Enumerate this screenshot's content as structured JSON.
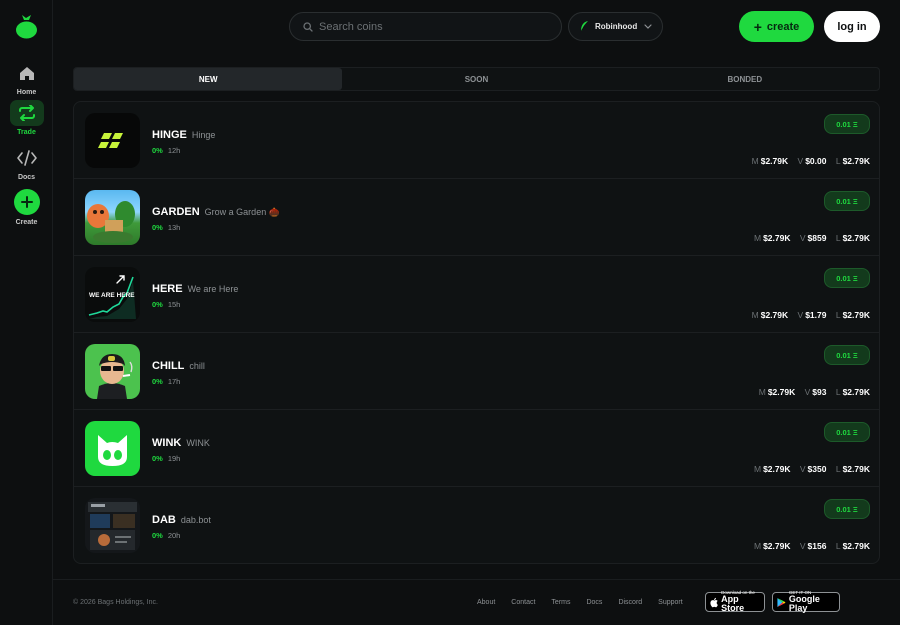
{
  "sidebar": {
    "items": [
      {
        "label": "Home",
        "icon": "home-icon"
      },
      {
        "label": "Trade",
        "icon": "swap-icon"
      },
      {
        "label": "Docs",
        "icon": "code-icon"
      },
      {
        "label": "Create",
        "icon": "plus-icon"
      }
    ]
  },
  "topbar": {
    "search_placeholder": "Search coins",
    "chain_label": "Robinhood",
    "create_label": "create",
    "login_label": "log in"
  },
  "tabs": [
    "NEW",
    "SOON",
    "BONDED"
  ],
  "coins": [
    {
      "ticker": "HINGE",
      "name": "Hinge",
      "change": "0%",
      "age": "12h",
      "buy": "0.01 Ξ",
      "m": "$2.79K",
      "v": "$0.00",
      "l": "$2.79K"
    },
    {
      "ticker": "GARDEN",
      "name": "Grow a Garden 🌰",
      "change": "0%",
      "age": "13h",
      "buy": "0.01 Ξ",
      "m": "$2.79K",
      "v": "$859",
      "l": "$2.79K"
    },
    {
      "ticker": "HERE",
      "name": "We are Here",
      "change": "0%",
      "age": "15h",
      "buy": "0.01 Ξ",
      "m": "$2.79K",
      "v": "$1.79",
      "l": "$2.79K"
    },
    {
      "ticker": "CHILL",
      "name": "chill",
      "change": "0%",
      "age": "17h",
      "buy": "0.01 Ξ",
      "m": "$2.79K",
      "v": "$93",
      "l": "$2.79K"
    },
    {
      "ticker": "WINK",
      "name": "WINK",
      "change": "0%",
      "age": "19h",
      "buy": "0.01 Ξ",
      "m": "$2.79K",
      "v": "$350",
      "l": "$2.79K"
    },
    {
      "ticker": "DAB",
      "name": "dab.bot",
      "change": "0%",
      "age": "20h",
      "buy": "0.01 Ξ",
      "m": "$2.79K",
      "v": "$156",
      "l": "$2.79K"
    }
  ],
  "stat_keys": {
    "m": "M",
    "v": "V",
    "l": "L"
  },
  "thumb_texts": {
    "here": "WE ARE HERE"
  },
  "footer": {
    "copyright": "© 2026 Bags Holdings, Inc.",
    "links": [
      "About",
      "Contact",
      "Terms",
      "Docs",
      "Discord",
      "Support"
    ],
    "app_store": {
      "top": "Download on the",
      "main": "App Store"
    },
    "google_play": {
      "top": "GET IT ON",
      "main": "Google Play"
    }
  },
  "colors": {
    "accent": "#1fd93f",
    "background": "#0d0f10",
    "card": "#0f1213"
  }
}
